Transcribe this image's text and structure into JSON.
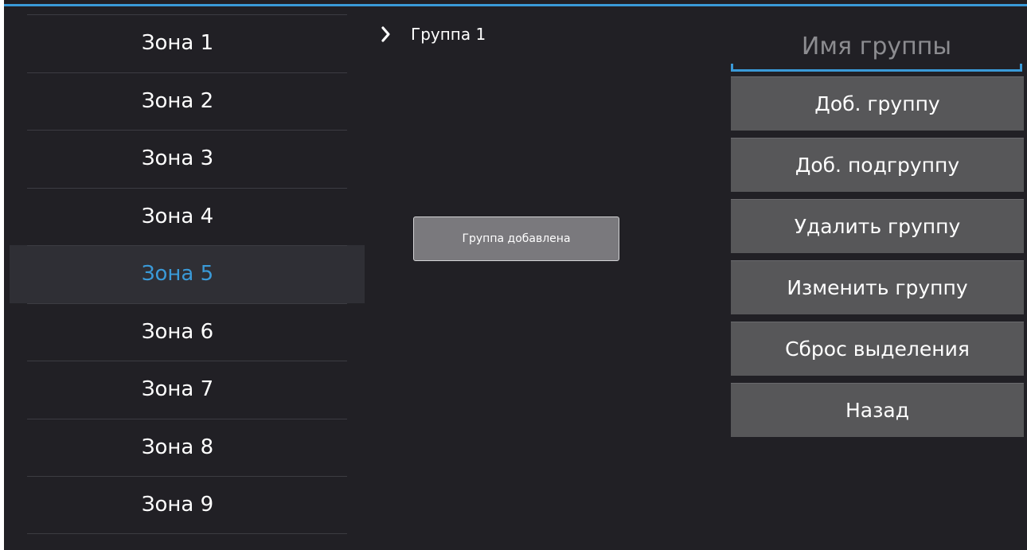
{
  "zones": {
    "items": [
      {
        "label": "Зона 1"
      },
      {
        "label": "Зона 2"
      },
      {
        "label": "Зона 3"
      },
      {
        "label": "Зона 4"
      },
      {
        "label": "Зона 5",
        "selected": true
      },
      {
        "label": "Зона 6"
      },
      {
        "label": "Зона 7"
      },
      {
        "label": "Зона 8"
      },
      {
        "label": "Зона 9"
      }
    ]
  },
  "tree": {
    "items": [
      {
        "label": "Группа 1",
        "icon": "chevron-right-icon"
      }
    ]
  },
  "toast": {
    "message": "Группа добавлена"
  },
  "group_form": {
    "name_placeholder": "Имя группы",
    "name_value": ""
  },
  "actions": {
    "add_group": "Доб. группу",
    "add_subgroup": "Доб. подгруппу",
    "delete_group": "Удалить группу",
    "edit_group": "Изменить группу",
    "reset_selection": "Сброс выделения",
    "back": "Назад"
  },
  "colors": {
    "background": "#212025",
    "accent": "#3a9ad8",
    "button": "#575759",
    "selected_row": "#2f2f35",
    "toast": "#7a797d"
  }
}
